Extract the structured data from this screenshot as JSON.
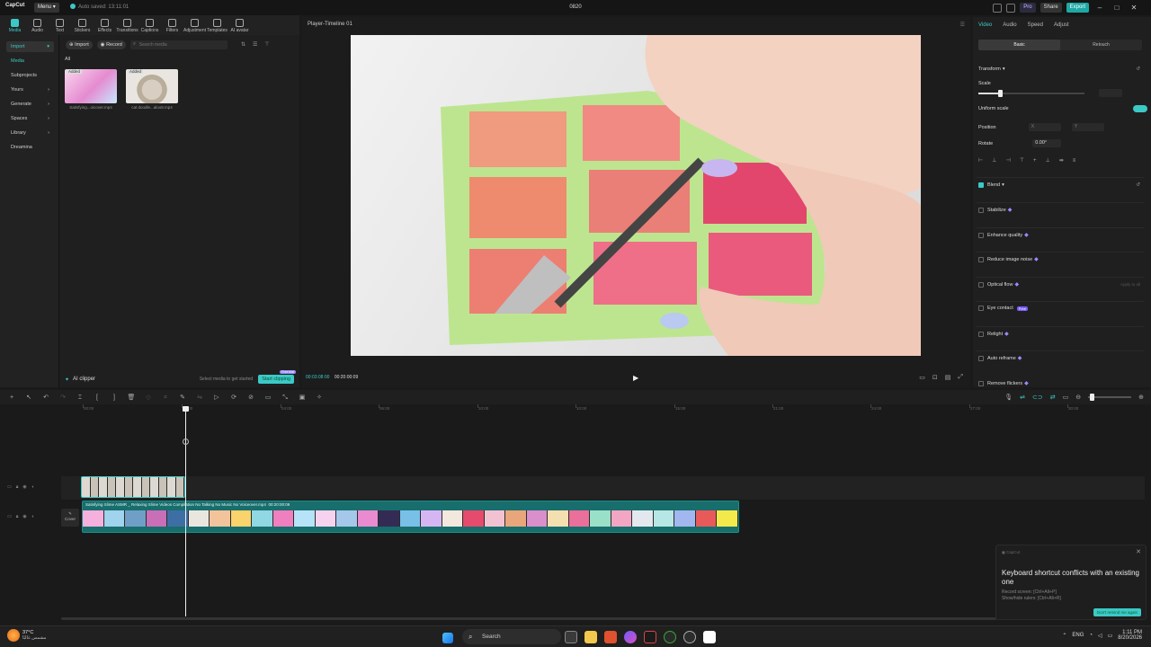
{
  "titlebar": {
    "logo": "CapCut",
    "menu": "Menu",
    "menu_caret": "▾",
    "autosave": "Auto saved: 13:11:01",
    "project": "0820",
    "pro": "Pro",
    "share": "Share",
    "export": "Export"
  },
  "toolbar": {
    "items": [
      "Media",
      "Audio",
      "Text",
      "Stickers",
      "Effects",
      "Transitions",
      "Captions",
      "Filters",
      "Adjustment",
      "Templates",
      "AI avatar"
    ]
  },
  "leftnav": {
    "items": [
      "Import",
      "Media",
      "Subprojects",
      "Yours",
      "Generate",
      "Spaces",
      "Library",
      "Dreamina"
    ]
  },
  "media": {
    "import": "Import",
    "record": "Record",
    "search_placeholder": "Search media",
    "all": "All",
    "thumb1_tag": "Added",
    "thumb1_caption": "Satisfying...oicover.mp4",
    "thumb2_tag": "Added",
    "thumb2_caption": "cat doodle...aloo8.mp4",
    "ai_clipper": "AI clipper",
    "select_hint": "Select media to get started",
    "start_clipping": "Start clipping",
    "badge": "Free trial"
  },
  "player": {
    "title": "Player-Timeline 01",
    "current_time": "00:03:08:00",
    "total_time": "00:20:00:09"
  },
  "props": {
    "tabs": [
      "Video",
      "Audio",
      "Speed",
      "Adjust"
    ],
    "seg": [
      "Basic",
      "Retouch"
    ],
    "transform": "Transform",
    "scale": "Scale",
    "uniform_scale": "Uniform scale",
    "position": "Position",
    "pos_x": "X",
    "pos_y": "Y",
    "rotate": "Rotate",
    "rotate_value": "0.00°",
    "blend": "Blend",
    "stabilize": "Stabilize",
    "enhance_quality": "Enhance quality",
    "reduce_noise": "Reduce image noise",
    "optical_flow": "Optical flow",
    "apply_all": "Apply to all",
    "eye_contact": "Eye contact",
    "free": "Free",
    "relight": "Relight",
    "auto_reframe": "Auto reframe",
    "remove_flickers": "Remove flickers"
  },
  "timeline": {
    "ticks": [
      "00:00",
      "02:00",
      "04:00",
      "06:00",
      "10:00",
      "10:00",
      "15:00",
      "21:00",
      "24:00",
      "27:00",
      "30:00"
    ],
    "cover": "Cover",
    "main_clip_label": "Satisfying Slime ASMR _ Relaxing Slime Videos Compilation No Talking No Music No Voiceover.mp4",
    "main_clip_duration": "00:20:00:09"
  },
  "toast": {
    "app": "CapCut",
    "title": "Keyboard shortcut conflicts with an existing one",
    "line1": "Record screen: [Ctrl+Alt+P]",
    "line2": "Show/hide rulers: [Ctrl+Alt+R]",
    "button": "Don't remind me again"
  },
  "taskbar": {
    "temp": "37°C",
    "weather": "مشمس غالبًا",
    "search": "Search",
    "lang": "ENG",
    "time": "1:11 PM",
    "date": "8/20/2026"
  },
  "colors": {
    "accent": "#3cc9c6",
    "pro": "#9b8cff"
  }
}
